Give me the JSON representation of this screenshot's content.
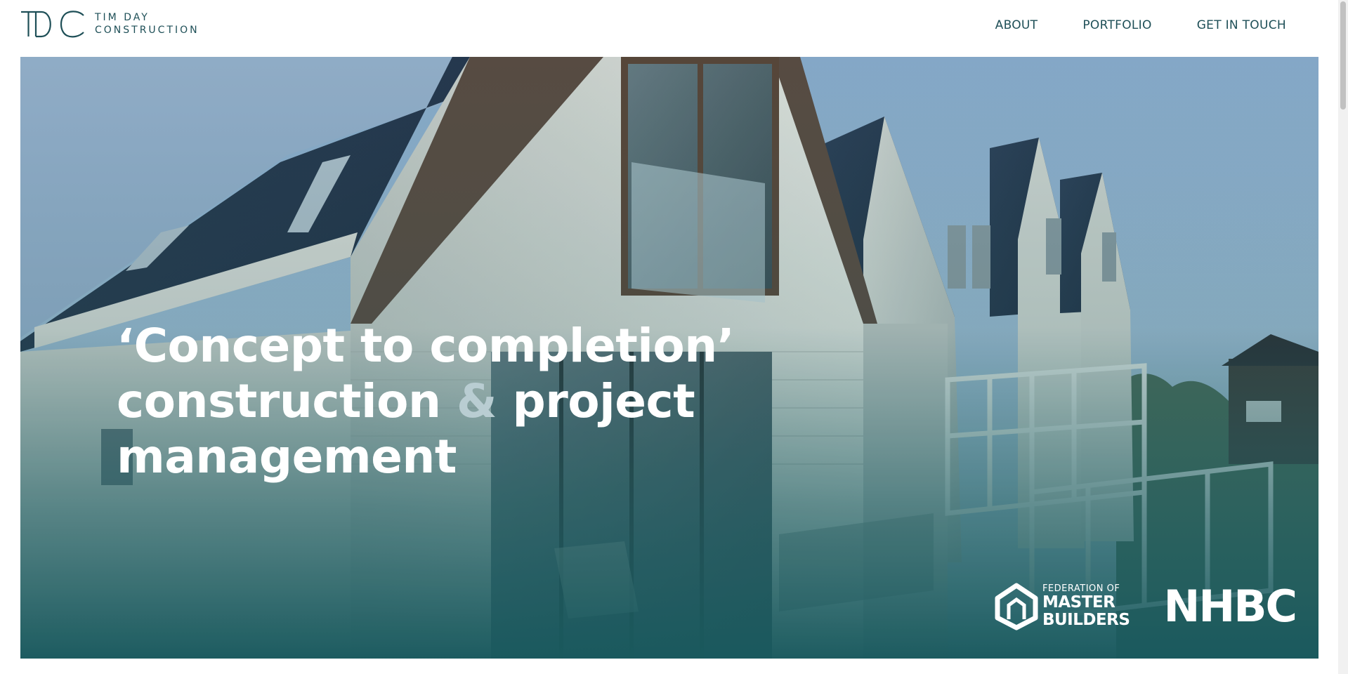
{
  "brand": {
    "monogram": "TDC",
    "name_line1": "TIM DAY",
    "name_line2": "CONSTRUCTION",
    "color": "#1e4f57"
  },
  "nav": {
    "items": [
      {
        "label": "ABOUT"
      },
      {
        "label": "PORTFOLIO"
      },
      {
        "label": "GET IN TOUCH"
      }
    ]
  },
  "hero": {
    "headline_line1": "‘Concept to completion’",
    "headline_line2_a": "construction ",
    "headline_amp": "&",
    "headline_line2_b": " project",
    "headline_line3": "management",
    "overlay_color": "#1f5f63"
  },
  "badges": {
    "fmb_line1": "FEDERATION OF",
    "fmb_line2": "MASTER",
    "fmb_line3": "BUILDERS",
    "nhbc": "NHBC"
  },
  "icons": {
    "fmb_logo": "house-outline-icon",
    "brand_logo": "tdc-monogram-icon"
  }
}
